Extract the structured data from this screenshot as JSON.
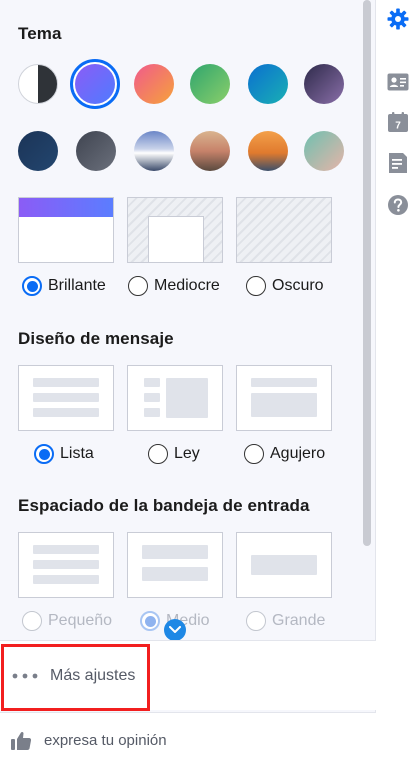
{
  "theme": {
    "heading": "Tema",
    "swatches_row1": [
      "split-black-white",
      "violet-blue",
      "orange-pink",
      "green",
      "teal-blue",
      "purple-dark"
    ],
    "swatches_row2": [
      "navy",
      "slate",
      "mountain",
      "desert-road",
      "kangaroo-orange",
      "beach"
    ],
    "selected_swatch": "violet-blue",
    "modes": [
      {
        "label": "Brillante",
        "checked": true
      },
      {
        "label": "Mediocre",
        "checked": false
      },
      {
        "label": "Oscuro",
        "checked": false
      }
    ]
  },
  "layout": {
    "heading": "Diseño de mensaje",
    "options": [
      {
        "label": "Lista",
        "checked": true
      },
      {
        "label": "Ley",
        "checked": false
      },
      {
        "label": "Agujero",
        "checked": false
      }
    ]
  },
  "spacing": {
    "heading": "Espaciado de la bandeja de entrada",
    "options": [
      {
        "label": "Pequeño",
        "checked": false
      },
      {
        "label": "Medio",
        "checked": true
      },
      {
        "label": "Grande",
        "checked": false
      }
    ]
  },
  "footer": {
    "more_settings": "Más ajustes",
    "feedback": "expresa tu opinión"
  },
  "rail": {
    "calendar_day": "7",
    "icons": [
      "gear-icon",
      "contacts-icon",
      "calendar-icon",
      "notes-icon",
      "help-icon"
    ]
  },
  "colors": {
    "accent": "#0a6cf5",
    "highlight": "#f21f1f"
  }
}
